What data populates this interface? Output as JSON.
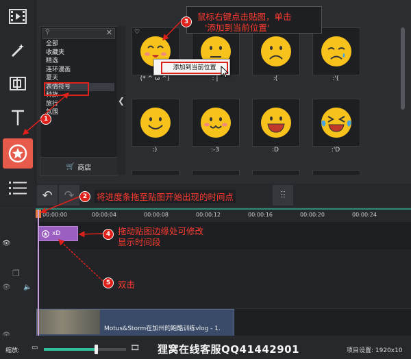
{
  "sidebar": {
    "tools": [
      {
        "icon": "film-icon"
      },
      {
        "icon": "magic-wand-icon"
      },
      {
        "icon": "transition-icon"
      },
      {
        "icon": "text-icon"
      },
      {
        "icon": "sticker-icon"
      },
      {
        "icon": "list-icon"
      }
    ]
  },
  "browser": {
    "categories": [
      "全部",
      "收藏夹",
      "精选",
      "连环漫画",
      "夏天",
      "表情符号",
      "种族",
      "旅行",
      "氛围"
    ],
    "selected_index": 5,
    "shop_label": "商店"
  },
  "stickers": [
    {
      "caption": "(* ^ ω ^)"
    },
    {
      "caption": ": |"
    },
    {
      "caption": ":("
    },
    {
      "caption": ":'("
    },
    {
      "caption": ":)"
    },
    {
      "caption": ":-3"
    },
    {
      "caption": ":D"
    },
    {
      "caption": ":'D"
    }
  ],
  "context_menu": {
    "item": "添加到当前位置"
  },
  "annotations": {
    "n1": "1",
    "n2": "2",
    "n3": "3",
    "n4": "4",
    "n5": "5",
    "note1_line1": "鼠标右键点击贴图，单击",
    "note1_line2": "'添加到当前位置'",
    "note2": "将进度条拖至贴图开始出现的时间点",
    "note4_line1": "拖动贴图边缘处可修改",
    "note4_line2": "显示时间段",
    "note5": "双击"
  },
  "timeline": {
    "ticks": [
      "00:00:00",
      "00:00:04",
      "00:00:08",
      "00:00:12",
      "00:00:16",
      "00:00:20",
      "00:00:24"
    ],
    "sticker_clip_label": "xD",
    "video_title": "Motus&Storm在加州的跑酷训练vlog - 1."
  },
  "bottom": {
    "zoom_label": "缩放:",
    "zoom_value": 0.63,
    "watermark": "狸窝在线客服QQ41442901",
    "project_settings": "项目设置: 1920x10"
  },
  "colors": {
    "accent": "#e55a4a",
    "annotation": "#ff3b30",
    "sticker_clip": "#9a5fc0",
    "timeline_accent": "#2f8a78"
  }
}
